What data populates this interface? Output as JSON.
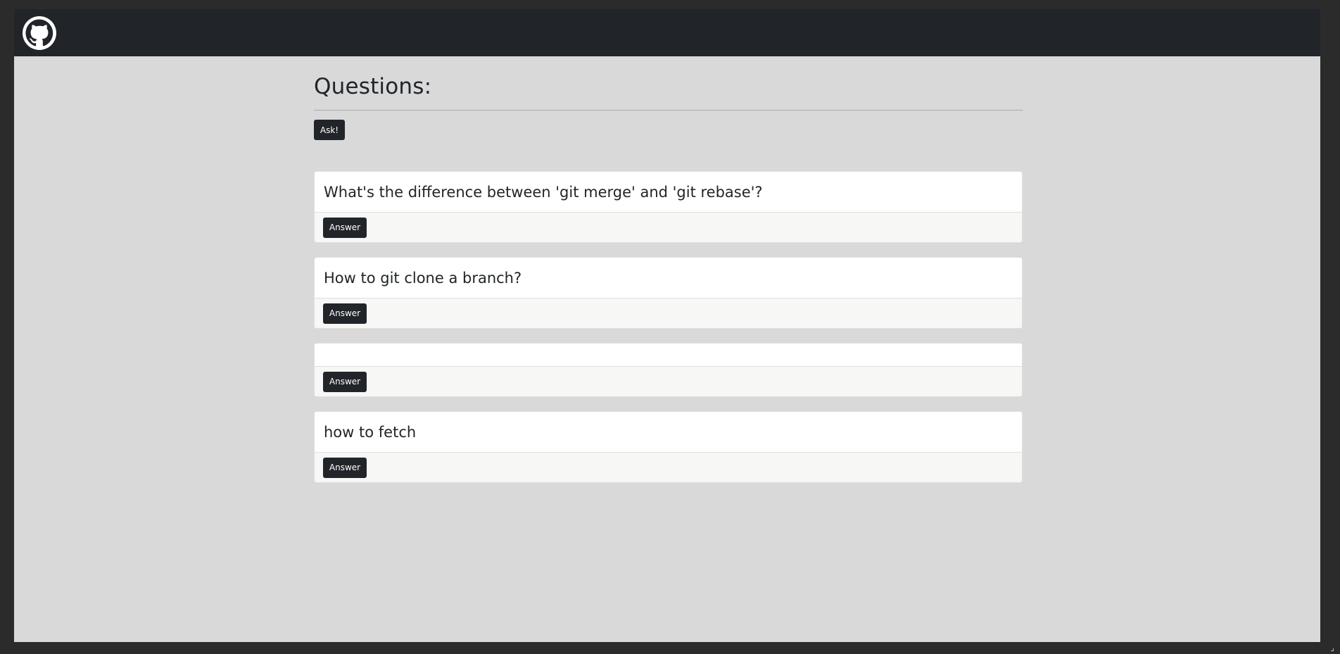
{
  "navbar": {
    "logo_icon": "github-icon"
  },
  "main": {
    "title": "Questions:",
    "ask_label": "Ask!"
  },
  "questions": [
    {
      "title": "What's the difference between 'git merge' and 'git rebase'?",
      "answer_label": "Answer"
    },
    {
      "title": "How to git clone a branch?",
      "answer_label": "Answer"
    },
    {
      "title": "",
      "answer_label": "Answer"
    },
    {
      "title": "how to fetch",
      "answer_label": "Answer"
    }
  ],
  "colors": {
    "navbar": "#212529",
    "page_background": "#d9d9d9",
    "button": "#212529",
    "card_footer": "#f7f7f6"
  }
}
